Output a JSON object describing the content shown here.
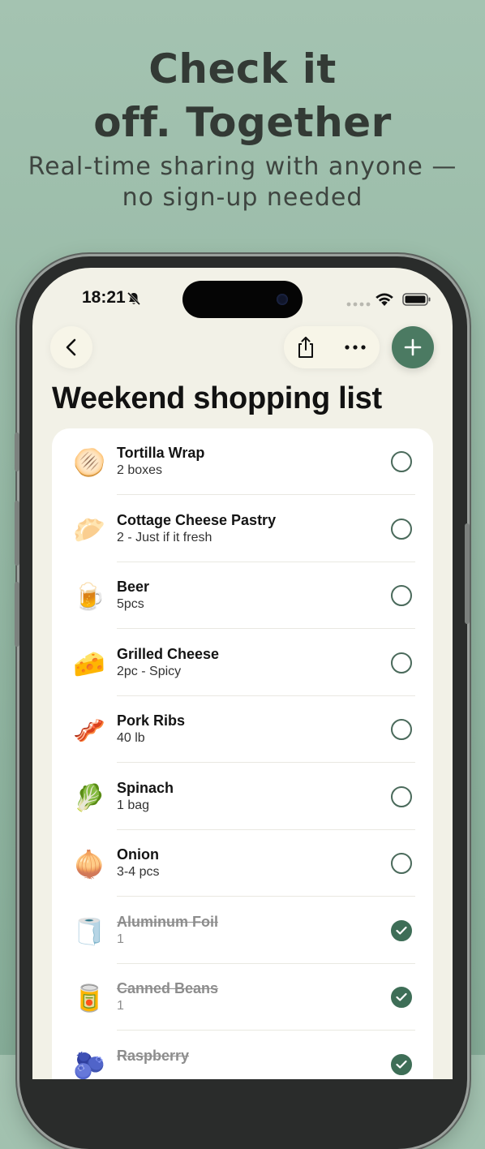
{
  "headline": {
    "line1": "Check it",
    "line2": "off. Together"
  },
  "subheadline": {
    "line1": "Real-time sharing with anyone —",
    "line2": "no sign-up needed"
  },
  "status_bar": {
    "time": "18:21"
  },
  "list": {
    "title": "Weekend shopping list",
    "items": [
      {
        "emoji": "🫓",
        "name": "Tortilla Wrap",
        "qty": "2 boxes",
        "checked": false
      },
      {
        "emoji": "🥟",
        "name": "Cottage Cheese Pastry",
        "qty": "2 - Just if it fresh",
        "checked": false
      },
      {
        "emoji": "🍺",
        "name": "Beer",
        "qty": "5pcs",
        "checked": false
      },
      {
        "emoji": "🧀",
        "name": "Grilled Cheese",
        "qty": "2pc - Spicy",
        "checked": false
      },
      {
        "emoji": "🥓",
        "name": "Pork Ribs",
        "qty": "40 lb",
        "checked": false
      },
      {
        "emoji": "🥬",
        "name": "Spinach",
        "qty": "1 bag",
        "checked": false
      },
      {
        "emoji": "🧅",
        "name": "Onion",
        "qty": "3-4 pcs",
        "checked": false
      },
      {
        "emoji": "🧻",
        "name": "Aluminum Foil",
        "qty": "1",
        "checked": true
      },
      {
        "emoji": "🥫",
        "name": "Canned Beans",
        "qty": "1",
        "checked": true
      },
      {
        "emoji": "🫐",
        "name": "Raspberry",
        "qty": "",
        "checked": true
      }
    ]
  },
  "colors": {
    "accent": "#4b7a62",
    "background": "#a4c3b1",
    "screen": "#f2f1e7"
  },
  "icons": [
    "back-chevron-icon",
    "share-icon",
    "more-icon",
    "plus-icon",
    "bell-off-icon",
    "wifi-icon",
    "battery-icon",
    "checkmark-icon"
  ]
}
